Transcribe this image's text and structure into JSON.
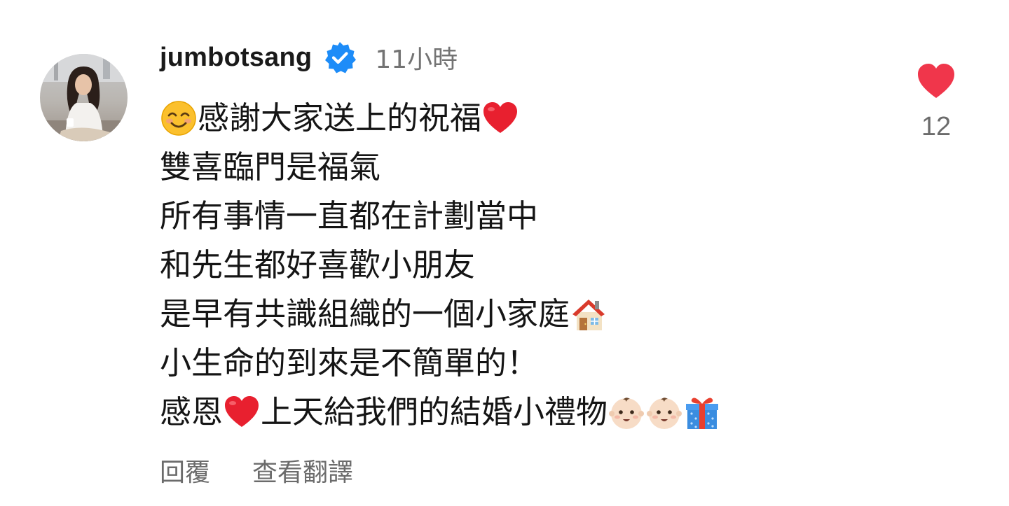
{
  "comment": {
    "username": "jumbotsang",
    "verified": true,
    "timestamp": "11小時",
    "lines": [
      {
        "emoji_before": "smiling-face-icon",
        "text": "感謝大家送上的祝福",
        "emoji_after": [
          "red-heart-icon"
        ]
      },
      {
        "text": "雙喜臨門是福氣"
      },
      {
        "text": "所有事情一直都在計劃當中"
      },
      {
        "text": "和先生都好喜歡小朋友"
      },
      {
        "text": "是早有共識組織的一個小家庭",
        "emoji_after": [
          "house-icon"
        ]
      },
      {
        "text": "小生命的到來是不簡單的！"
      },
      {
        "text_a": "感恩",
        "emoji_mid": "red-heart-icon",
        "text_b": "上天給我們的結婚小禮物",
        "emoji_after": [
          "baby-face-icon",
          "baby-face-icon",
          "gift-icon"
        ]
      }
    ],
    "line1": "感謝大家送上的祝福",
    "line2": "雙喜臨門是福氣",
    "line3": "所有事情一直都在計劃當中",
    "line4": "和先生都好喜歡小朋友",
    "line5": "是早有共識組織的一個小家庭",
    "line6": "小生命的到來是不簡單的！",
    "line7_a": "感恩",
    "line7_b": "上天給我們的結婚小禮物",
    "actions": {
      "reply": "回覆",
      "translate": "查看翻譯"
    },
    "likes": {
      "count": "12",
      "icon": "heart-icon",
      "liked": true
    }
  },
  "colors": {
    "like_heart": "#f0364b",
    "verified_badge": "#1d8cf8",
    "secondary_text": "#737373"
  }
}
